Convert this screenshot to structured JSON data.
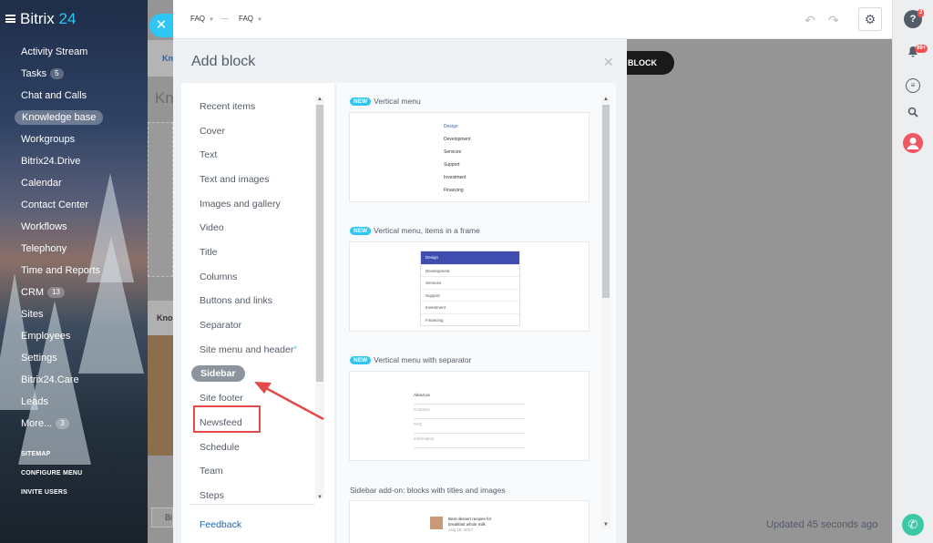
{
  "app": {
    "logo_word": "Bitrix",
    "logo_num": "24"
  },
  "sidebar": {
    "items": [
      {
        "label": "Activity Stream"
      },
      {
        "label": "Tasks",
        "count": "5"
      },
      {
        "label": "Chat and Calls"
      },
      {
        "label": "Knowledge base",
        "active": true
      },
      {
        "label": "Workgroups"
      },
      {
        "label": "Bitrix24.Drive"
      },
      {
        "label": "Calendar"
      },
      {
        "label": "Contact Center"
      },
      {
        "label": "Workflows"
      },
      {
        "label": "Telephony"
      },
      {
        "label": "Time and Reports"
      },
      {
        "label": "CRM",
        "count": "13"
      },
      {
        "label": "Sites"
      },
      {
        "label": "Employees"
      },
      {
        "label": "Settings"
      },
      {
        "label": "Bitrix24.Care"
      },
      {
        "label": "Leads"
      },
      {
        "label": "More...",
        "count": "3"
      }
    ],
    "links": [
      "SITEMAP",
      "CONFIGURE MENU",
      "INVITE USERS"
    ]
  },
  "topbar": {
    "crumb1": "FAQ",
    "sep": "—",
    "crumb2": "FAQ"
  },
  "background": {
    "tab_fragment": "Kn",
    "heading_fragment": "Kn",
    "card_fragment": "Kno",
    "button_fragment": "BLOCK",
    "bottom_button_fragment": "Bi",
    "updated": "Updated 45 seconds ago"
  },
  "right_panel": {
    "help_badge": "2",
    "notify_badge": "99+"
  },
  "dialog": {
    "title": "Add block",
    "categories": [
      "Recent items",
      "Cover",
      "Text",
      "Text and images",
      "Images and gallery",
      "Video",
      "Title",
      "Columns",
      "Buttons and links",
      "Separator",
      "Site menu and header",
      "Sidebar",
      "Site footer",
      "Newsfeed",
      "Schedule",
      "Team",
      "Steps"
    ],
    "feedback": "Feedback",
    "new_label": "NEW",
    "blocks": [
      {
        "title": "Vertical menu",
        "new": true,
        "items": [
          "Design",
          "Development",
          "Services",
          "Support",
          "Investment",
          "Financing"
        ]
      },
      {
        "title": "Vertical menu, items in a frame",
        "new": true,
        "items": [
          "Design",
          "Development",
          "Services",
          "Support",
          "Investment",
          "Financing"
        ]
      },
      {
        "title": "Vertical menu with separator",
        "new": true,
        "items": [
          "About us",
          "Contacts",
          "FAQ",
          "Information"
        ]
      },
      {
        "title": "Sidebar add-on: blocks with titles and images",
        "new": false,
        "news_title": "Best dessert recipes for breakfast whole milk",
        "news_date": "Aug 18, 2017"
      }
    ]
  },
  "colors": {
    "accent": "#2fc6f6",
    "selected_bg": "#8c949d",
    "highlight_red": "#e34a4a",
    "link": "#2067b0",
    "call_green": "#3bc8a5"
  }
}
